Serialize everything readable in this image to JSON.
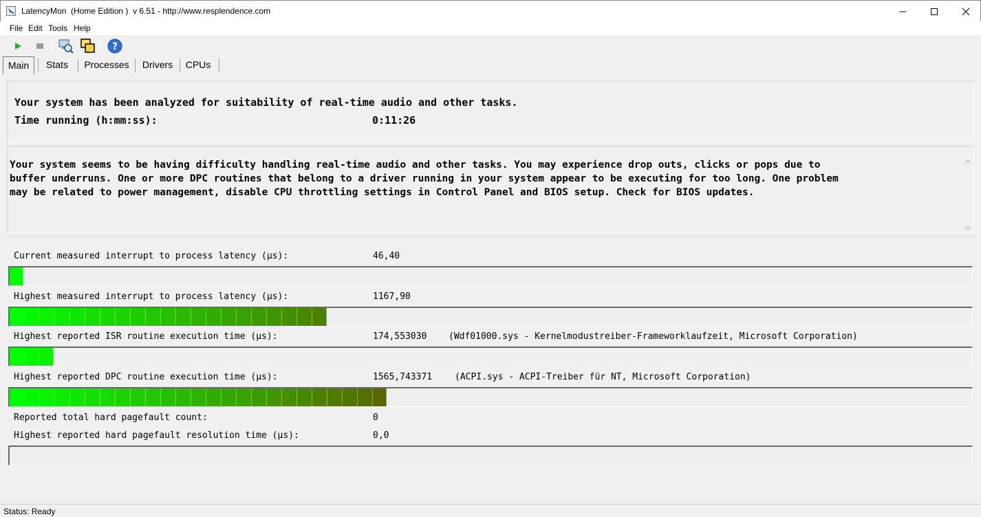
{
  "window": {
    "title": "LatencyMon  (Home Edition )  v 6.51 - http://www.resplendence.com",
    "icon": "latencymon-app-icon"
  },
  "menu": [
    "File",
    "Edit",
    "Tools",
    "Help"
  ],
  "toolbar": {
    "icons": [
      "play-icon",
      "stop-icon",
      "process-search-icon",
      "windows-icon",
      "help-icon"
    ]
  },
  "tabs": [
    "Main",
    "Stats",
    "Processes",
    "Drivers",
    "CPUs"
  ],
  "summary": {
    "analyzed_line": "Your system has been analyzed for suitability of real-time audio and other tasks.",
    "time_label": "Time running (h:mm:ss):",
    "time_value": "0:11:26"
  },
  "assessment": {
    "line1": "Your system seems to be having difficulty handling real-time audio and other tasks. You may experience drop outs, clicks or pops due to",
    "line2": "buffer underruns. One or more DPC routines that belong to a driver running in your system appear to be executing for too long. One problem",
    "line3": "may be related to power management, disable CPU throttling settings in Control Panel and BIOS setup. Check for BIOS updates."
  },
  "metrics": {
    "current_latency": {
      "label": "Current measured interrupt to process latency (µs):",
      "value": "46,40",
      "bar_fraction": 0.014
    },
    "highest_latency": {
      "label": "Highest measured interrupt to process latency (µs):",
      "value": "1167,90",
      "bar_fraction": 0.33
    },
    "highest_isr": {
      "label": "Highest reported ISR routine execution time (µs):",
      "value": "174,553030",
      "detail": "(Wdf01000.sys - Kernelmodustreiber-Frameworklaufzeit, Microsoft Corporation)",
      "bar_fraction": 0.046
    },
    "highest_dpc": {
      "label": "Highest reported DPC routine execution time (µs):",
      "value": "1565,743371",
      "detail": "(ACPI.sys - ACPI-Treiber für NT, Microsoft Corporation)",
      "bar_fraction": 0.392
    },
    "pagefault_count": {
      "label": "Reported total hard pagefault count:",
      "value": "0"
    },
    "pagefault_time": {
      "label": "Highest reported hard pagefault resolution time (µs):",
      "value": "0,0",
      "bar_fraction": 0
    }
  },
  "colors": {
    "bar_start": "#00ff00",
    "bar_end": "#6b4b00"
  },
  "status": "Status: Ready"
}
